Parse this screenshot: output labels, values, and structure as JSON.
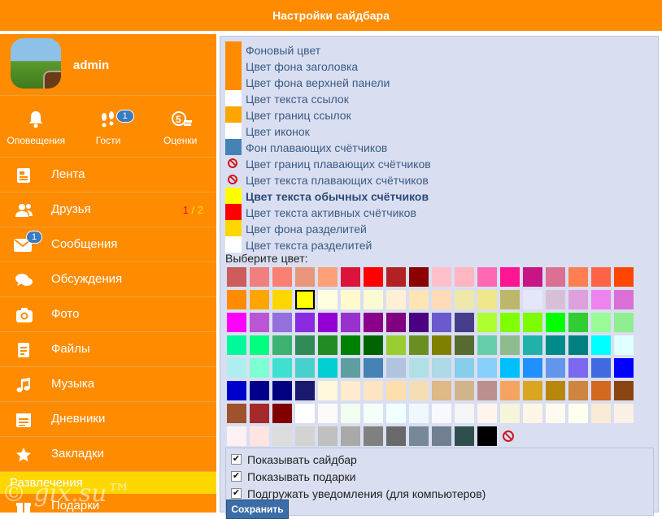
{
  "header": {
    "title": "Настройки сайдбара"
  },
  "user": {
    "name": "admin"
  },
  "quick": [
    {
      "label": "Оповещения",
      "icon": "bell-icon",
      "badge": ""
    },
    {
      "label": "Гости",
      "icon": "footprints-icon",
      "badge": "1"
    },
    {
      "label": "Оценки",
      "icon": "rating-five-icon",
      "badge": ""
    }
  ],
  "menu": [
    {
      "label": "Лента",
      "icon": "feed-icon"
    },
    {
      "label": "Друзья",
      "icon": "friends-icon",
      "count_a": "1",
      "count_sep": " / ",
      "count_b": "2"
    },
    {
      "label": "Сообщения",
      "icon": "envelope-icon",
      "badge": "1"
    },
    {
      "label": "Обсуждения",
      "icon": "chat-bubbles-icon"
    },
    {
      "label": "Фото",
      "icon": "camera-icon"
    },
    {
      "label": "Файлы",
      "icon": "file-icon"
    },
    {
      "label": "Музыка",
      "icon": "music-note-icon"
    },
    {
      "label": "Дневники",
      "icon": "diary-icon"
    },
    {
      "label": "Закладки",
      "icon": "star-icon"
    }
  ],
  "section": {
    "label": "Развлечения"
  },
  "partial_item": {
    "label": "Подарки",
    "icon": "gift-icon"
  },
  "watermark": "© gix.su™",
  "properties": [
    {
      "label": "Фоновый цвет",
      "color": "#ff8c00"
    },
    {
      "label": "Цвет фона заголовка",
      "color": "#ff8c00"
    },
    {
      "label": "Цвет фона верхней панели",
      "color": "#ff8c00"
    },
    {
      "label": "Цвет текста ссылок",
      "color": "#ffffff"
    },
    {
      "label": "Цвет границ ссылок",
      "color": "#ffa500"
    },
    {
      "label": "Цвет иконок",
      "color": "#ffffff"
    },
    {
      "label": "Фон плавающих счётчиков",
      "color": "#4682b4"
    },
    {
      "label": "Цвет границ плавающих счётчиков",
      "color": "none"
    },
    {
      "label": "Цвет текста плавающих счётчиков",
      "color": "none"
    },
    {
      "label": "Цвет текста обычных счётчиков",
      "color": "#ffff00"
    },
    {
      "label": "Цвет текста активных счётчиков",
      "color": "#ff0000"
    },
    {
      "label": "Цвет фона разделитей",
      "color": "#ffd700"
    },
    {
      "label": "Цвет текста разделитей",
      "color": "#ffffff"
    }
  ],
  "selected_property": "Цвет текста обычных счётчиков",
  "choose_label": "Выберите цвет:",
  "palette": [
    [
      "#cd5c5c",
      "#f08080",
      "#fa8072",
      "#e9967a",
      "#ffa07a",
      "#dc143c",
      "#ff0000",
      "#b22222",
      "#8b0000",
      "#ffc0cb",
      "#ffb6c1",
      "#ff69b4",
      "#ff1493",
      "#c71585",
      "#db7093",
      "#ff7f50",
      "#ff6347",
      "#ff4500"
    ],
    [
      "#ff8c00",
      "#ffa500",
      "#ffd700",
      "#ffff00",
      "#ffffe0",
      "#fffacd",
      "#fafad2",
      "#ffefd5",
      "#ffe4b5",
      "#ffdab9",
      "#eee8aa",
      "#f0e68c",
      "#bdb76b",
      "#e6e6fa",
      "#d8bfd8",
      "#dda0dd",
      "#ee82ee",
      "#da70d6"
    ],
    [
      "#ff00ff",
      "#ba55d3",
      "#9370db",
      "#8a2be2",
      "#9400d3",
      "#9932cc",
      "#8b008b",
      "#800080",
      "#4b0082",
      "#6a5acd",
      "#483d8b",
      "#adff2f",
      "#7fff00",
      "#7cfc00",
      "#00ff00",
      "#32cd32",
      "#98fb98",
      "#90ee90"
    ],
    [
      "#00fa9a",
      "#00ff7f",
      "#3cb371",
      "#2e8b57",
      "#228b22",
      "#008000",
      "#006400",
      "#9acd32",
      "#6b8e23",
      "#808000",
      "#556b2f",
      "#66cdaa",
      "#8fbc8f",
      "#20b2aa",
      "#008b8b",
      "#008080",
      "#00ffff",
      "#e0ffff"
    ],
    [
      "#afeeee",
      "#7fffd4",
      "#40e0d0",
      "#48d1cc",
      "#00ced1",
      "#5f9ea0",
      "#4682b4",
      "#b0c4de",
      "#b0e0e6",
      "#add8e6",
      "#87ceeb",
      "#87cefa",
      "#00bfff",
      "#1e90ff",
      "#6495ed",
      "#7b68ee",
      "#4169e1",
      "#0000ff"
    ],
    [
      "#0000cd",
      "#00008b",
      "#000080",
      "#191970",
      "#fff8dc",
      "#ffebcd",
      "#ffe4c4",
      "#ffdead",
      "#f5deb3",
      "#deb887",
      "#d2b48c",
      "#bc8f8f",
      "#f4a460",
      "#daa520",
      "#b8860b",
      "#cd853f",
      "#d2691e",
      "#8b4513"
    ],
    [
      "#a0522d",
      "#a52a2a",
      "#800000",
      "#ffffff",
      "#fffafa",
      "#f0fff0",
      "#f5fffa",
      "#f0ffff",
      "#f0f8ff",
      "#f8f8ff",
      "#f5f5f5",
      "#fff5ee",
      "#f5f5dc",
      "#fdf5e6",
      "#fffaf0",
      "#fffff0",
      "#faebd7",
      "#faf0e6"
    ],
    [
      "#fff0f5",
      "#ffe4e1",
      "#dcdcdc",
      "#d3d3d3",
      "#c0c0c0",
      "#a9a9a9",
      "#808080",
      "#696969",
      "#778899",
      "#708090",
      "#2f4f4f",
      "#000000",
      "none"
    ]
  ],
  "selected_color": "#ffff00",
  "options": [
    {
      "label": "Показывать сайдбар",
      "checked": true
    },
    {
      "label": "Показывать подарки",
      "checked": true
    },
    {
      "label": "Подгружать уведомления (для компьютеров)",
      "checked": true
    }
  ],
  "save_label": "Сохранить"
}
